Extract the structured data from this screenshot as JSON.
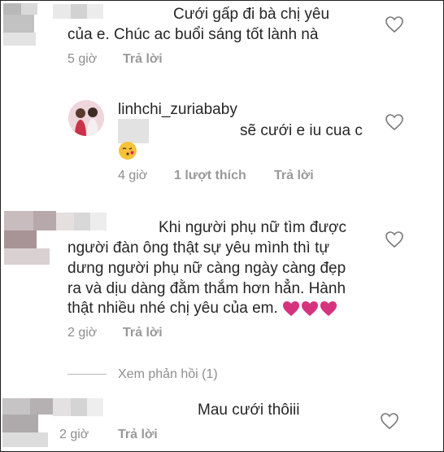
{
  "comments": [
    {
      "lines": [
        "Cưới gấp đi bà chị yêu",
        "của e. Chúc ac buổi sáng tốt lành nà"
      ],
      "time": "5 giờ",
      "reply": "Trả lời"
    },
    {
      "username": "linhchi_zuriababy",
      "text": "sẽ cưới e iu cua c",
      "time": "4 giờ",
      "likes": "1 lượt thích",
      "reply": "Trả lời"
    },
    {
      "lines": [
        "Khi người phụ nữ tìm được",
        "người đàn ông thật sự yêu mình thì tự",
        "dưng người phụ nữ càng ngày càng đẹp",
        "ra và dịu dàng đằm thắm hơn hẳn. Hành",
        "thật nhiều nhé chị yêu của em."
      ],
      "time": "2 giờ",
      "reply": "Trả lời",
      "view_replies": "Xem phản hồi (1)"
    },
    {
      "text": "Mau cưới thôiii",
      "time": "2 giờ",
      "reply": "Trả lời"
    }
  ],
  "icons": {
    "like": "heart-outline-icon",
    "pink_heart": "pink-heart-icon",
    "emoji": "kissing-face-emoji"
  },
  "colors": {
    "text": "#262626",
    "meta": "#8e8e8e",
    "pink_heart": "#d6337f",
    "emoji_face": "#f7c13a"
  }
}
